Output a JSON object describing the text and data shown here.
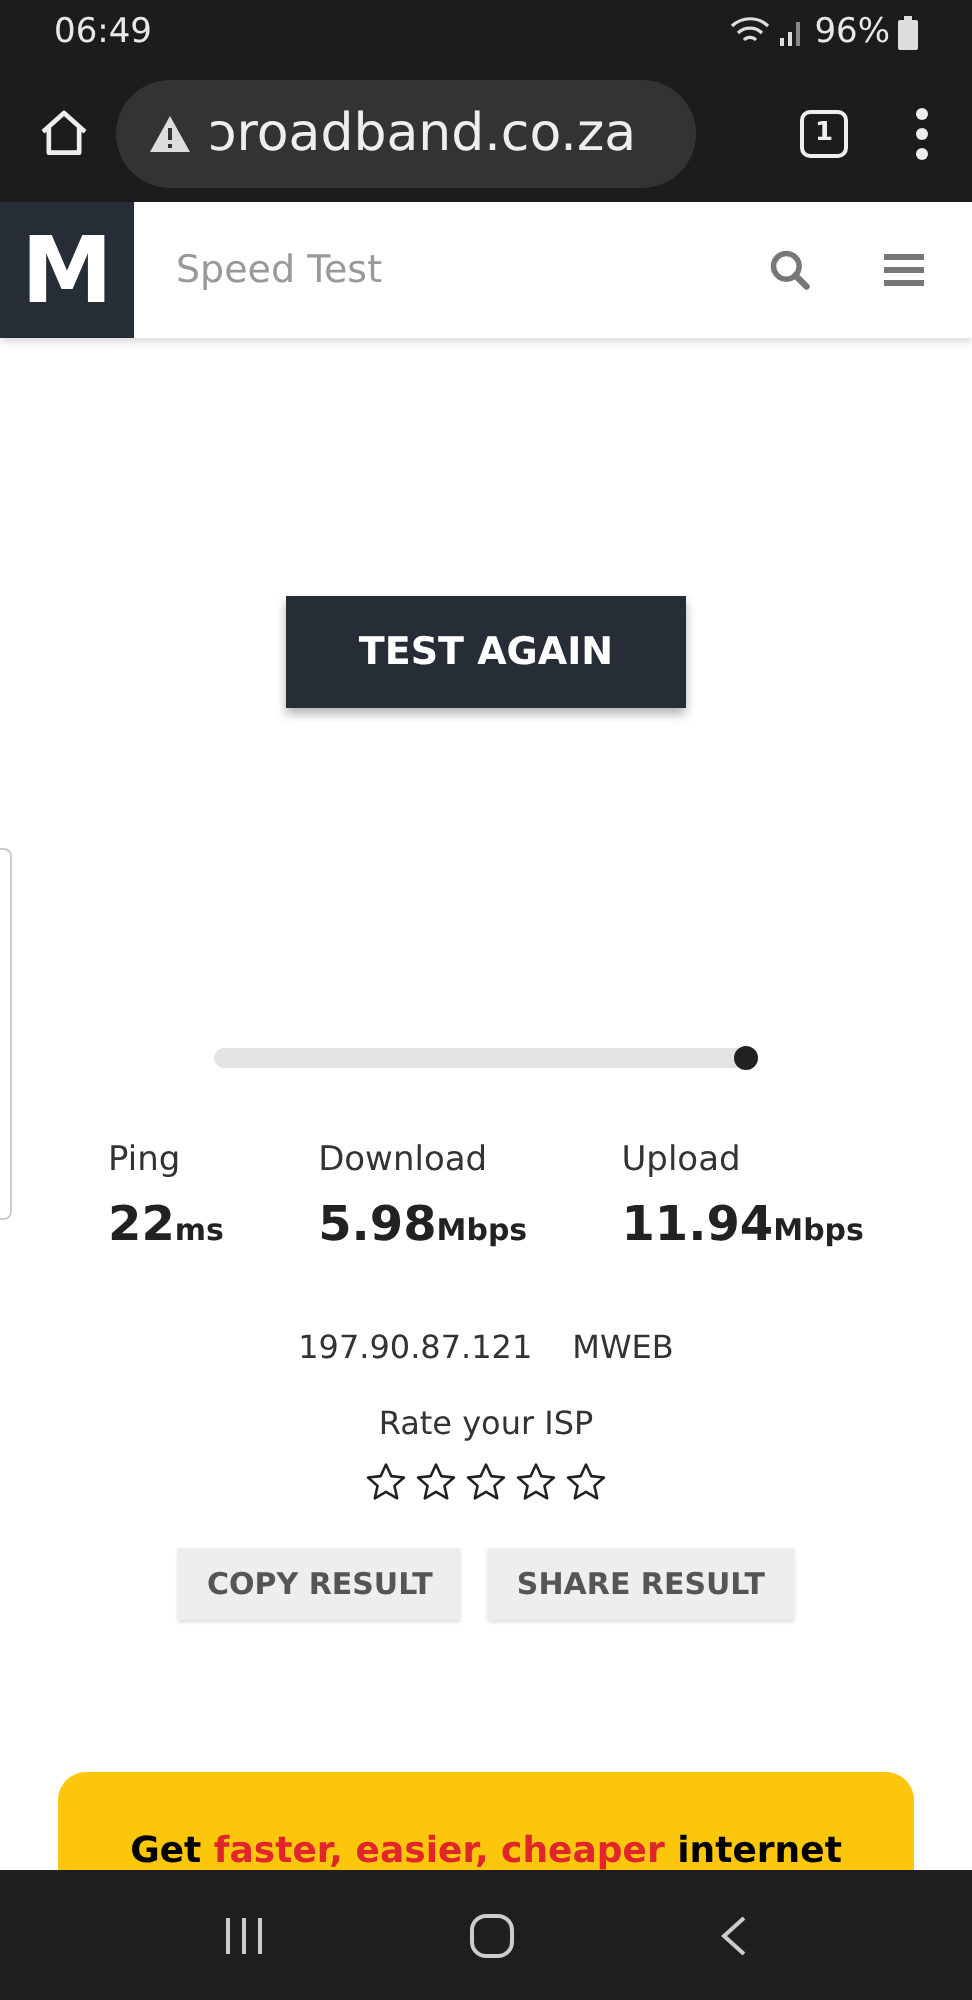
{
  "status_bar": {
    "time": "06:49",
    "battery": "96%"
  },
  "browser": {
    "url": "ɔroadband.co.za",
    "tab_count": "1"
  },
  "site_header": {
    "logo": "M",
    "title": "Speed Test"
  },
  "test_button": "TEST AGAIN",
  "progress": {
    "level": 1
  },
  "stats": [
    {
      "label": "Ping",
      "value": "22",
      "unit": "ms"
    },
    {
      "label": "Download",
      "value": "5.98",
      "unit": "Mbps"
    },
    {
      "label": "Upload",
      "value": "11.94",
      "unit": "Mbps"
    }
  ],
  "ip": "197.90.87.121",
  "isp": "MWEB",
  "rating": {
    "label": "Rate your ISP",
    "stars": 0
  },
  "actions": [
    "COPY RESULT",
    "SHARE RESULT"
  ],
  "ad": {
    "parts": [
      {
        "text": "Get ",
        "highlight": false
      },
      {
        "text": "faster, easier, cheaper",
        "highlight": true
      },
      {
        "text": " internet",
        "highlight": false
      }
    ]
  }
}
